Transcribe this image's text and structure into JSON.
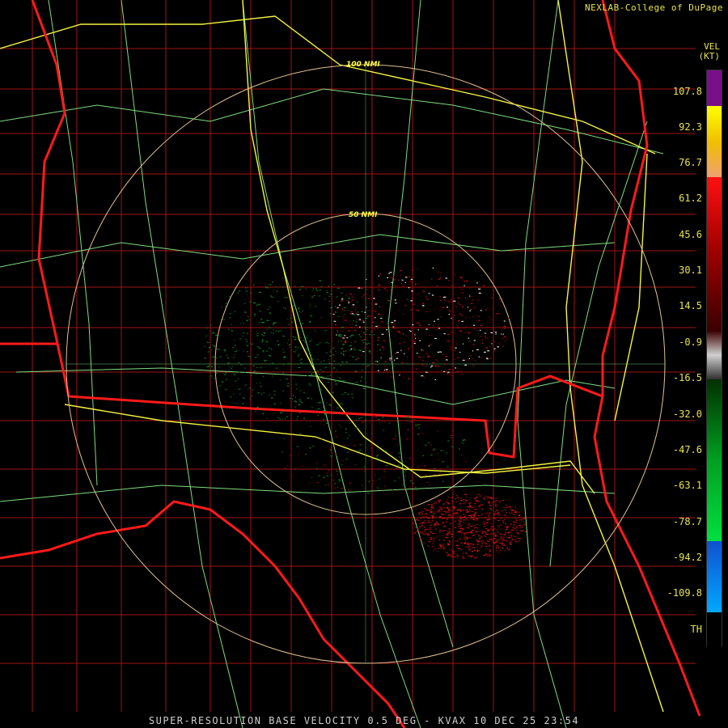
{
  "credit": "NEXLAB-College of DuPage",
  "legend": {
    "title_line1": "VEL",
    "title_line2": "(KT)",
    "labels": [
      "107.8",
      "92.3",
      "76.7",
      "61.2",
      "45.6",
      "30.1",
      "14.5",
      "-0.9",
      "-16.5",
      "-32.0",
      "-47.6",
      "-63.1",
      "-78.7",
      "-94.2",
      "-109.8",
      "TH"
    ],
    "colors": {
      "purple": "#7a0f8a",
      "yellow": "#ffff00",
      "peach": "#f0a070",
      "red": "#e01010",
      "dark_red": "#5a0000",
      "gray": "#b0b0b0",
      "dark_green": "#005000",
      "green": "#00e040",
      "blue": "#1060e0",
      "cyan": "#00b0ff",
      "black": "#000000"
    }
  },
  "range_rings": {
    "inner_label": "50 NMI",
    "outer_label": "100 NMI"
  },
  "map_colors": {
    "state_line": "#ff1a1a",
    "county_line": "#b01818",
    "highway": "#80e080",
    "interstate": "#ffff40",
    "ring": "#e0c090"
  },
  "caption": "SUPER-RESOLUTION BASE VELOCITY 0.5 DEG - KVAX 10 DEC 25 23:54"
}
